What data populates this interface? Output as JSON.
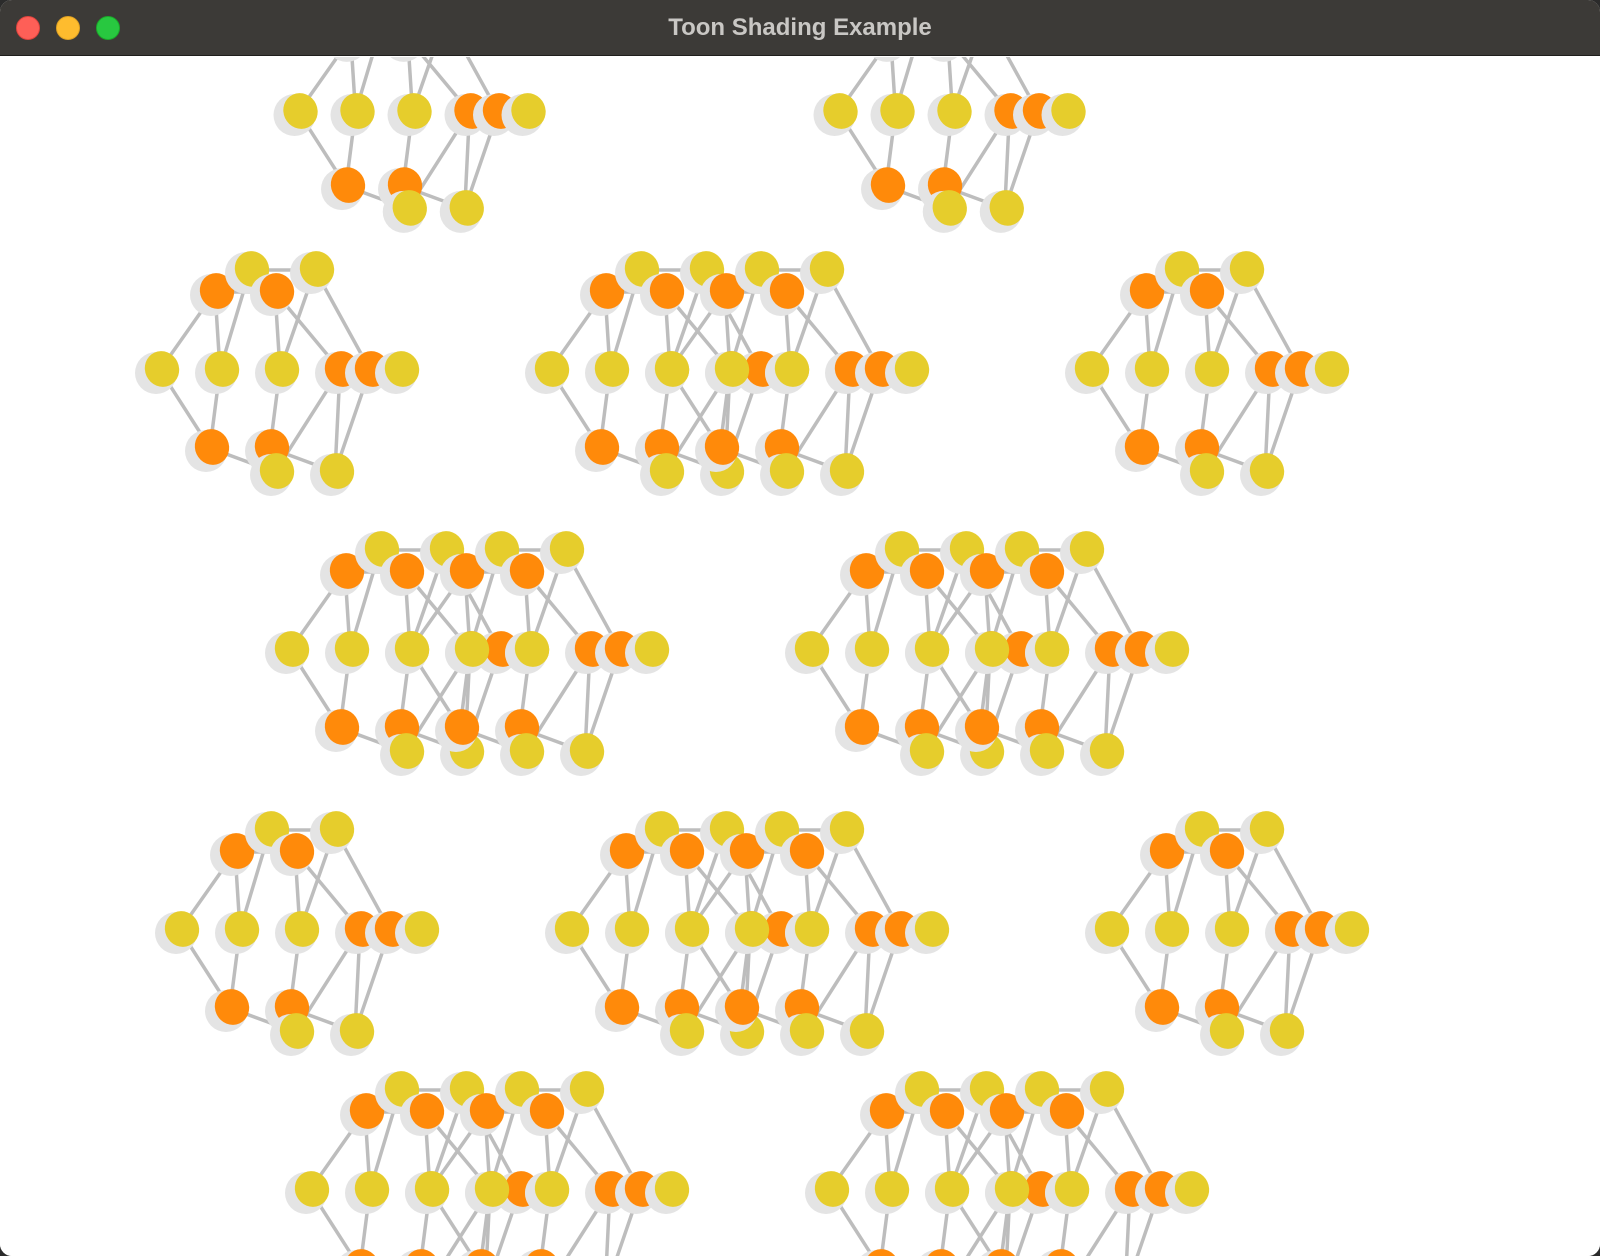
{
  "window": {
    "title": "Toon Shading Example",
    "controls": {
      "close": "close-button",
      "minimize": "minimize-button",
      "zoom": "zoom-button"
    }
  },
  "colors": {
    "titlebar": "#3c3a37",
    "canvas_background": "#ffffff",
    "sphere_yellow": "#e6cd2c",
    "sphere_orange": "#ff8a0a",
    "sphere_shadow": "#e4e4e4",
    "bond": "#bdbdbd",
    "close": "#fe5f57",
    "minimize": "#febc2e",
    "zoom": "#28c840"
  },
  "scene": {
    "description_icon": "molecular-lattice-render",
    "rendering_style": "toon-shaded"
  }
}
